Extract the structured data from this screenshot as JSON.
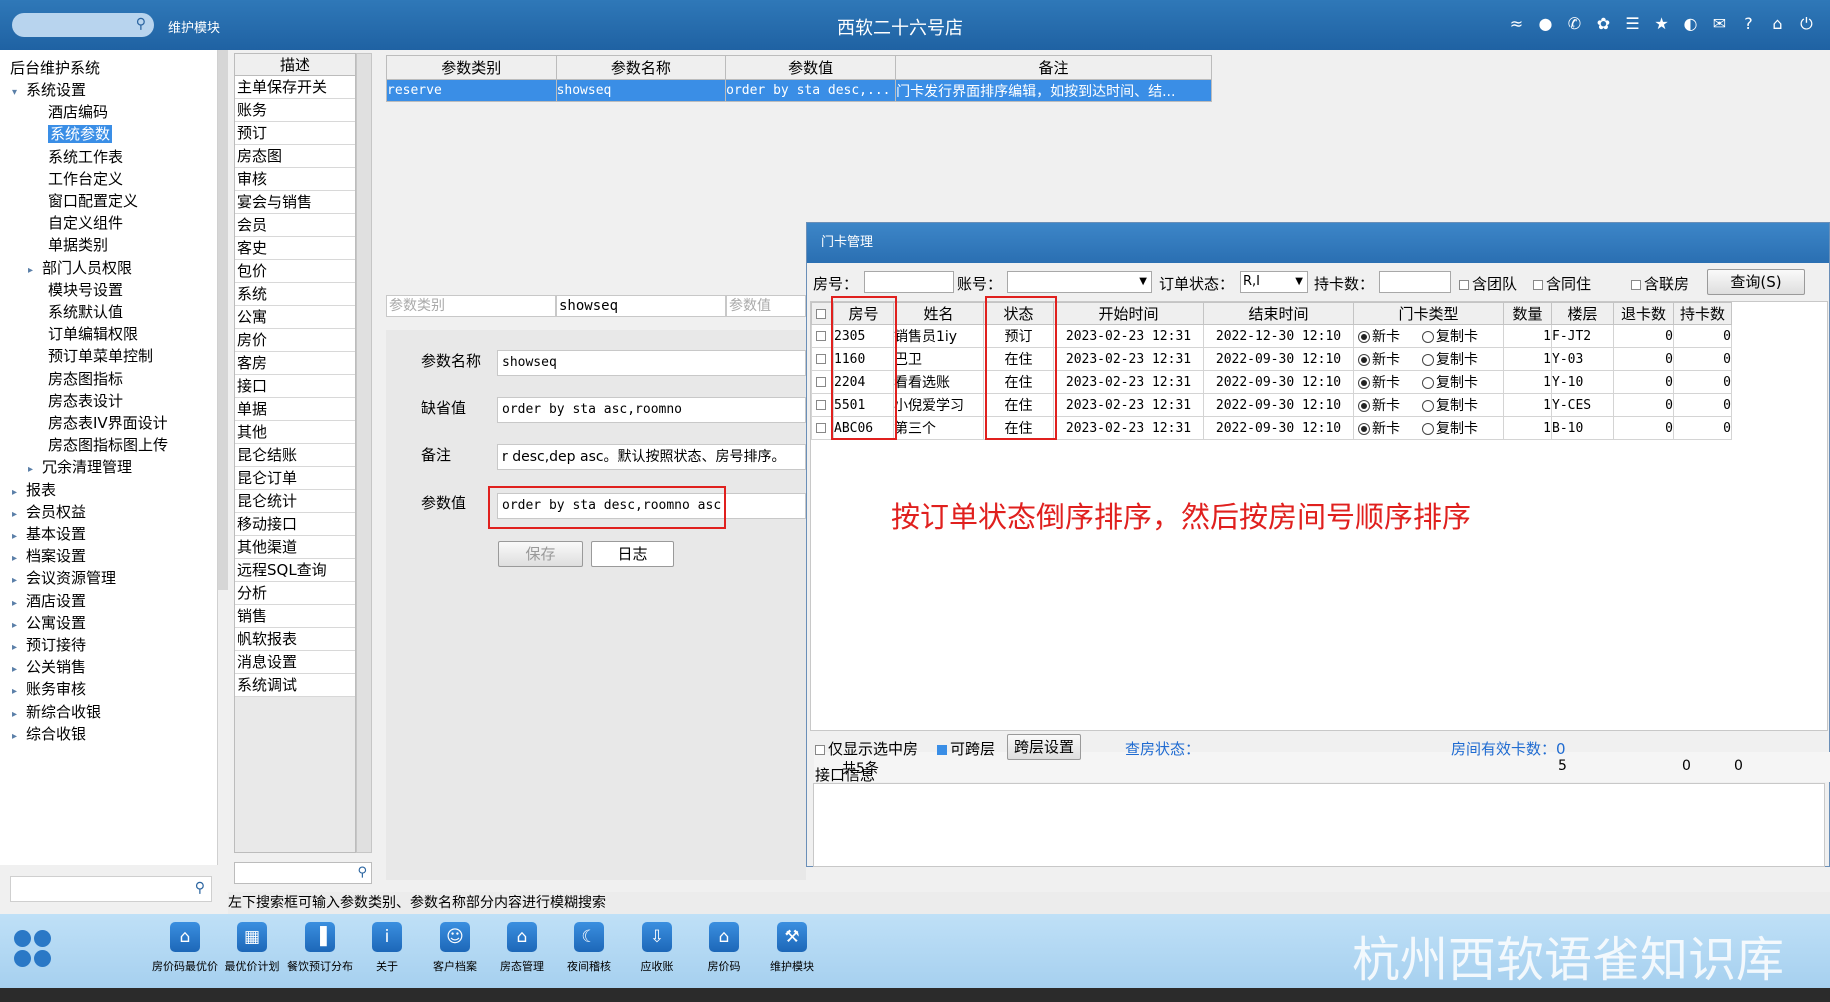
{
  "topbar": {
    "module": "维护模块",
    "store": "西软二十六号店",
    "icons": [
      "wifi-icon",
      "chat-icon",
      "phone-icon",
      "palette-icon",
      "menu-icon",
      "star-icon",
      "contrast-icon",
      "mail-icon",
      "help-icon",
      "home-icon",
      "power-icon"
    ]
  },
  "tree": {
    "root": "后台维护系统",
    "items": [
      {
        "label": "系统设置",
        "level": 1,
        "expanded": true
      },
      {
        "label": "酒店编码",
        "level": 2
      },
      {
        "label": "系统参数",
        "level": 2,
        "selected": true
      },
      {
        "label": "系统工作表",
        "level": 2
      },
      {
        "label": "工作台定义",
        "level": 2
      },
      {
        "label": "窗口配置定义",
        "level": 2
      },
      {
        "label": "自定义组件",
        "level": 2
      },
      {
        "label": "单据类别",
        "level": 2
      },
      {
        "label": "部门人员权限",
        "level": 2,
        "arrow": true
      },
      {
        "label": "模块号设置",
        "level": 2
      },
      {
        "label": "系统默认值",
        "level": 2
      },
      {
        "label": "订单编辑权限",
        "level": 2
      },
      {
        "label": "预订单菜单控制",
        "level": 2
      },
      {
        "label": "房态图指标",
        "level": 2
      },
      {
        "label": "房态表设计",
        "level": 2
      },
      {
        "label": "房态表IV界面设计",
        "level": 2
      },
      {
        "label": "房态图指标图上传",
        "level": 2
      },
      {
        "label": "冗余清理管理",
        "level": 2,
        "arrow": true
      },
      {
        "label": "报表",
        "level": 1
      },
      {
        "label": "会员权益",
        "level": 1
      },
      {
        "label": "基本设置",
        "level": 1
      },
      {
        "label": "档案设置",
        "level": 1
      },
      {
        "label": "会议资源管理",
        "level": 1
      },
      {
        "label": "酒店设置",
        "level": 1
      },
      {
        "label": "公寓设置",
        "level": 1
      },
      {
        "label": "预订接待",
        "level": 1
      },
      {
        "label": "公关销售",
        "level": 1
      },
      {
        "label": "账务审核",
        "level": 1
      },
      {
        "label": "新综合收银",
        "level": 1
      },
      {
        "label": "综合收银",
        "level": 1
      }
    ]
  },
  "desc": {
    "header": "描述",
    "items": [
      "主单保存开关",
      "账务",
      "预订",
      "房态图",
      "审核",
      "宴会与销售",
      "会员",
      "客史",
      "包价",
      "系统",
      "公寓",
      "房价",
      "客房",
      "接口",
      "单据",
      "其他",
      "昆仑结账",
      "昆仑订单",
      "昆仑统计",
      "移动接口",
      "其他渠道",
      "远程SQL查询",
      "分析",
      "销售",
      "帆软报表",
      "消息设置",
      "系统调试"
    ]
  },
  "params": {
    "headers": [
      "参数类别",
      "参数名称",
      "参数值",
      "备注"
    ],
    "row": [
      "reserve",
      "showseq",
      "order by sta desc,...",
      "门卡发行界面排序编辑，如按到达时间、结..."
    ],
    "filter": [
      "参数类别",
      "showseq",
      "参数值"
    ]
  },
  "detail": {
    "name_label": "参数名称",
    "name_value": "showseq",
    "default_label": "缺省值",
    "default_value": "order by sta asc,roomno",
    "remark_label": "备注",
    "remark_value": "r desc,dep asc。默认按照状态、房号排序。",
    "value_label": "参数值",
    "value_value": "order by sta desc,roomno asc",
    "save": "保存",
    "log": "日志"
  },
  "dialog": {
    "title": "门卡管理",
    "room_label": "房号：",
    "acct_label": "账号：",
    "status_label": "订单状态：",
    "status_value": "R,I",
    "cards_label": "持卡数：",
    "cb_group": "含团队",
    "cb_same": "含同住",
    "cb_linked": "含联房",
    "query": "查询(S)",
    "columns": [
      "房号",
      "姓名",
      "状态",
      "开始时间",
      "结束时间",
      "门卡类型",
      "数量",
      "楼层",
      "退卡数",
      "持卡数"
    ],
    "radio_new": "新卡",
    "radio_copy": "复制卡",
    "rows": [
      {
        "room": "2305",
        "name": "销售员1iy",
        "status": "预订",
        "start": "2023-02-23  12:31",
        "end": "2022-12-30  12:10",
        "qty": "1",
        "floor": "F-JT2",
        "ret": "0",
        "hold": "0"
      },
      {
        "room": "1160",
        "name": "巴卫",
        "status": "在住",
        "start": "2023-02-23  12:31",
        "end": "2022-09-30  12:10",
        "qty": "1",
        "floor": "Y-03",
        "ret": "0",
        "hold": "0"
      },
      {
        "room": "2204",
        "name": "看看选账",
        "status": "在住",
        "start": "2023-02-23  12:31",
        "end": "2022-09-30  12:10",
        "qty": "1",
        "floor": "Y-10",
        "ret": "0",
        "hold": "0"
      },
      {
        "room": "5501",
        "name": "小倪爱学习",
        "status": "在住",
        "start": "2023-02-23  12:31",
        "end": "2022-09-30  12:10",
        "qty": "1",
        "floor": "Y-CES",
        "ret": "0",
        "hold": "0"
      },
      {
        "room": "ABC06",
        "name": "第三个",
        "status": "在住",
        "start": "2023-02-23  12:31",
        "end": "2022-09-30  12:10",
        "qty": "1",
        "floor": "B-10",
        "ret": "0",
        "hold": "0"
      }
    ],
    "summary_count": "共5条",
    "summary_qty": "5",
    "summary_ret": "0",
    "summary_hold": "0",
    "only_selected": "仅显示选中房",
    "cross_floor": "可跨层",
    "cross_btn": "跨层设置",
    "check_status": "查房状态：",
    "valid_cards": "房间有效卡数：0",
    "iface_label": "接口信息"
  },
  "annotation": "按订单状态倒序排序，然后按房间号顺序排序",
  "status_hint": "左下搜索框可输入参数类别、参数名称部分内容进行模糊搜索",
  "taskbar": [
    {
      "label": "房价码最优价",
      "icon": "house-price-icon"
    },
    {
      "label": "最优价计划",
      "icon": "calendar-icon"
    },
    {
      "label": "餐饮预订分布",
      "icon": "chart-icon"
    },
    {
      "label": "关于",
      "icon": "info-icon"
    },
    {
      "label": "客户档案",
      "icon": "contact-icon"
    },
    {
      "label": "房态管理",
      "icon": "house-icon"
    },
    {
      "label": "夜间稽核",
      "icon": "moon-icon"
    },
    {
      "label": "应收账",
      "icon": "download-icon"
    },
    {
      "label": "房价码",
      "icon": "home-icon"
    },
    {
      "label": "维护模块",
      "icon": "wrench-icon"
    }
  ],
  "watermark": "杭州西软语雀知识库"
}
